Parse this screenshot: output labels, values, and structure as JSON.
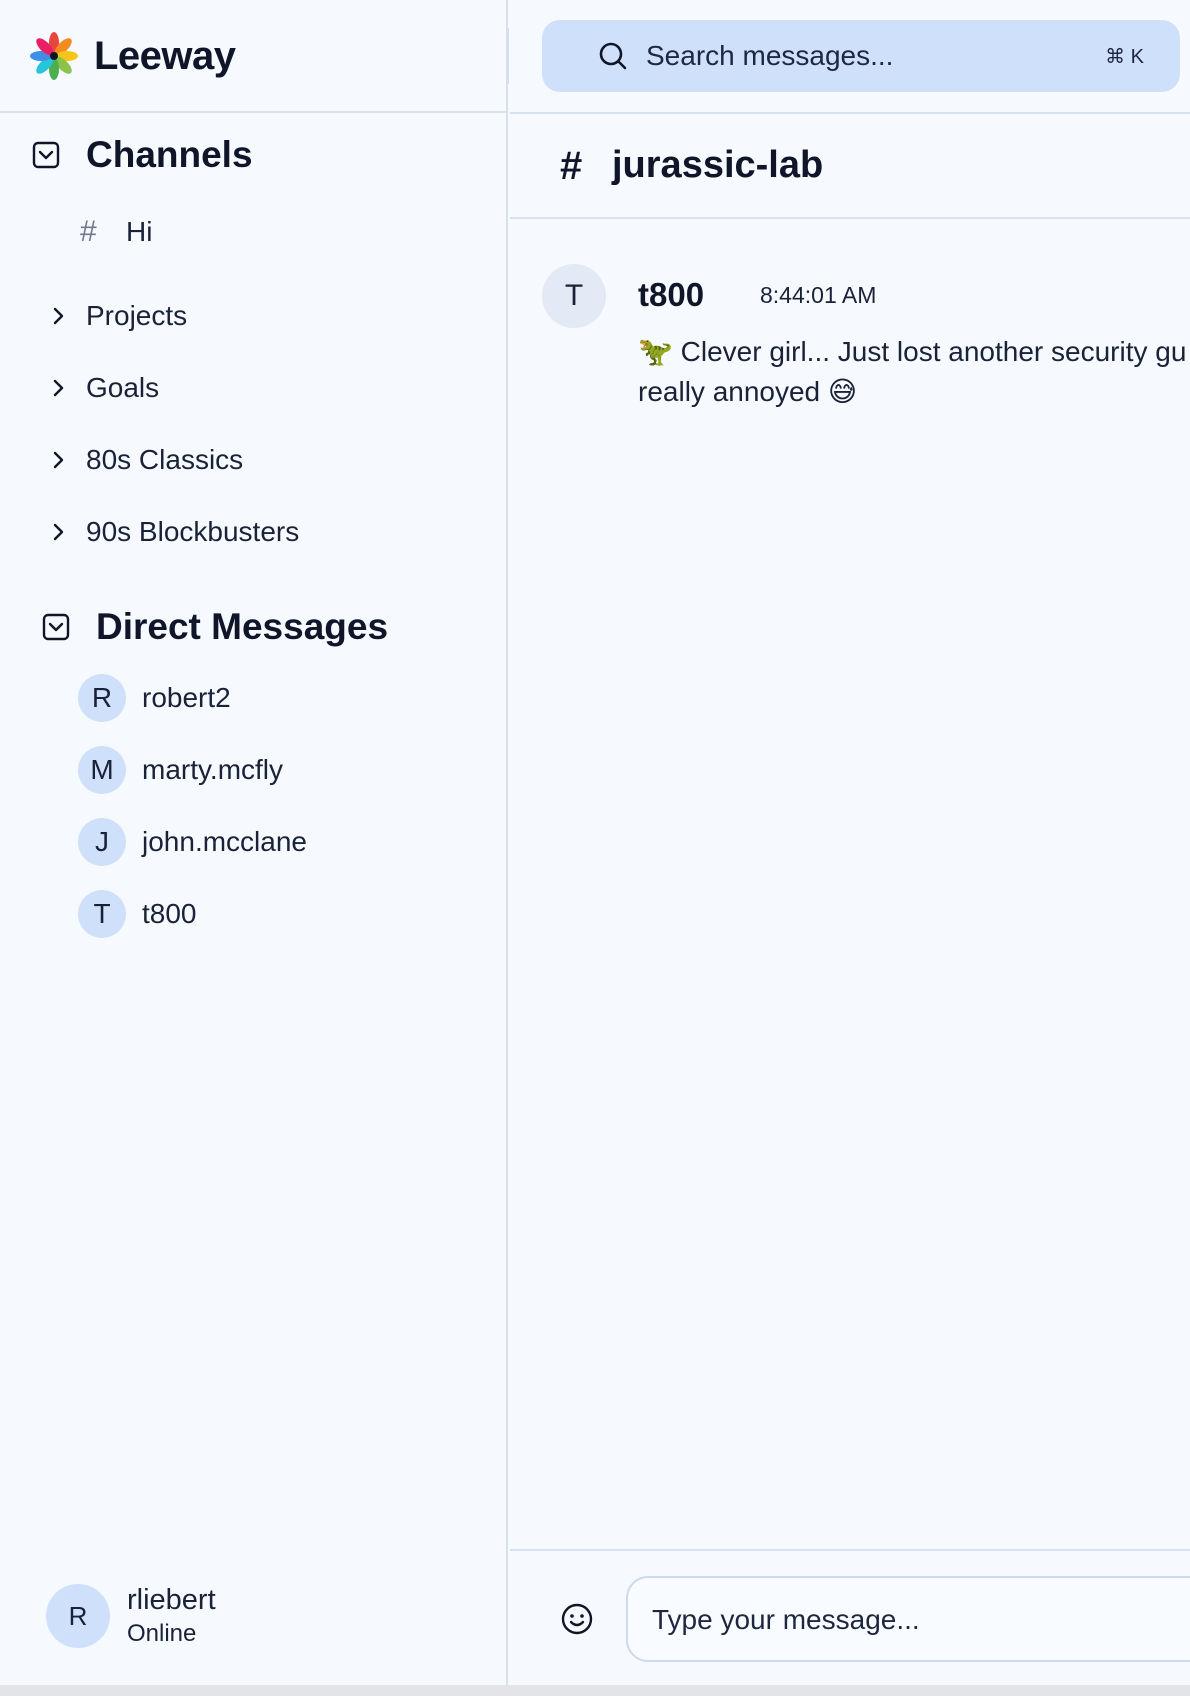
{
  "app": {
    "name": "Leeway"
  },
  "search": {
    "placeholder": "Search messages...",
    "shortcut": "⌘ K"
  },
  "sidebar": {
    "channels_title": "Channels",
    "channels": [
      {
        "label": "Hi",
        "icon": "hash-icon",
        "expandable": false
      }
    ],
    "groups": [
      {
        "label": "Projects"
      },
      {
        "label": "Goals"
      },
      {
        "label": "80s Classics"
      },
      {
        "label": "90s Blockbusters"
      }
    ],
    "dm_title": "Direct Messages",
    "dms": [
      {
        "initial": "R",
        "name": "robert2"
      },
      {
        "initial": "M",
        "name": "marty.mcfly"
      },
      {
        "initial": "J",
        "name": "john.mcclane"
      },
      {
        "initial": "T",
        "name": "t800"
      }
    ],
    "user": {
      "initial": "R",
      "name": "rliebert",
      "status": "Online"
    }
  },
  "main": {
    "channel_hash": "#",
    "channel_name": "jurassic-lab",
    "messages": [
      {
        "initial": "T",
        "author": "t800",
        "time": "8:44:01 AM",
        "line1": "🦖 Clever girl... Just lost another security gu",
        "line2": "really annoyed 😅"
      }
    ],
    "composer": {
      "placeholder": "Type your message..."
    }
  },
  "colors": {
    "background": "#f6f9fd",
    "accent_light": "#cfe0fb",
    "border": "#d5e1f1",
    "text": "#10162a"
  }
}
